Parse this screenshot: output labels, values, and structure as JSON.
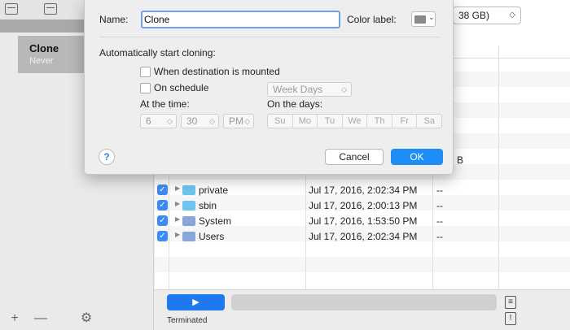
{
  "sidebar": {
    "title_fragment": "Clo",
    "task": {
      "name": "Clone",
      "subtitle": "Never"
    },
    "bottom_buttons": [
      "+",
      "—",
      "⚙"
    ]
  },
  "destination": {
    "value": "38 GB)"
  },
  "files": [
    {
      "name": "private",
      "date": "Jul 17, 2016, 2:02:34 PM",
      "size": "--",
      "icon": "folder-icon"
    },
    {
      "name": "sbin",
      "date": "Jul 17, 2016, 2:00:13 PM",
      "size": "--",
      "icon": "folder-icon"
    },
    {
      "name": "System",
      "date": "Jul 17, 2016, 1:53:50 PM",
      "size": "--",
      "icon": "system-folder-icon"
    },
    {
      "name": "Users",
      "date": "Jul 17, 2016, 2:02:34 PM",
      "size": "--",
      "icon": "users-folder-icon"
    }
  ],
  "partial_size_text": "B",
  "footer": {
    "play_label": "▶",
    "status": "Terminated"
  },
  "dialog": {
    "name_label": "Name:",
    "name_value": "Clone",
    "color_label": "Color label:",
    "auto_section": "Automatically start cloning:",
    "when_mounted": "When destination is mounted",
    "on_schedule": "On schedule",
    "schedule_select": "Week Days",
    "at_time_label": "At the time:",
    "on_days_label": "On the days:",
    "hour": "6",
    "minute": "30",
    "ampm": "PM",
    "days": [
      "Su",
      "Mo",
      "Tu",
      "We",
      "Th",
      "Fr",
      "Sa"
    ],
    "help": "?",
    "cancel": "Cancel",
    "ok": "OK"
  },
  "colors": {
    "accent": "#1e8df5",
    "folder": "#6fc3f0",
    "sheet_bg": "#eeeeee"
  }
}
